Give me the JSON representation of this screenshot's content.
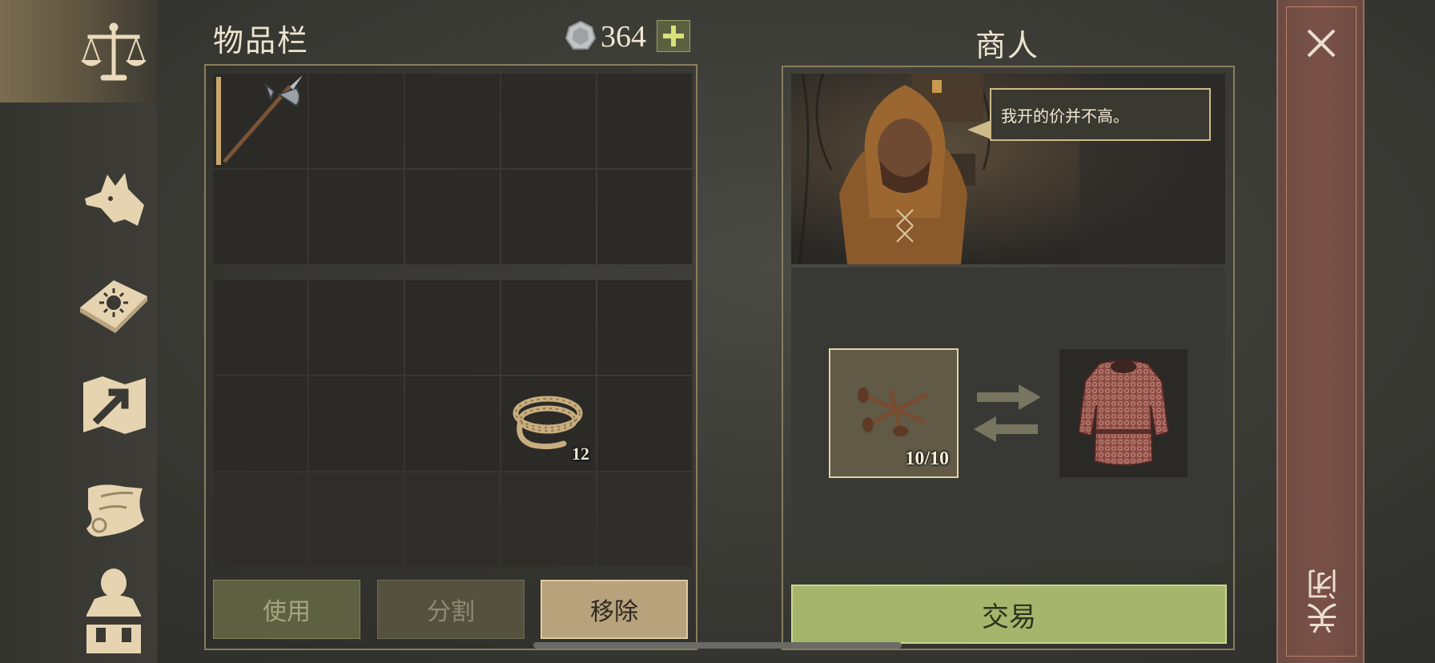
{
  "inventory": {
    "title": "物品栏",
    "currency_amount": "364",
    "add_label": "+",
    "rope_count": "12",
    "buttons": {
      "use": "使用",
      "split": "分割",
      "remove": "移除"
    }
  },
  "merchant": {
    "title": "商人",
    "speech": "我开的价并不高。",
    "offer_count": "10/10",
    "trade_label": "交易"
  },
  "close_label": "关闭",
  "nav_icons": [
    "scales-icon",
    "wolf-icon",
    "sun-book-icon",
    "map-icon",
    "scroll-quill-icon",
    "character-icon"
  ],
  "colors": {
    "accent_tan": "#c9a76c",
    "trade_green": "#a7b46b",
    "close_red": "#7a5148"
  }
}
